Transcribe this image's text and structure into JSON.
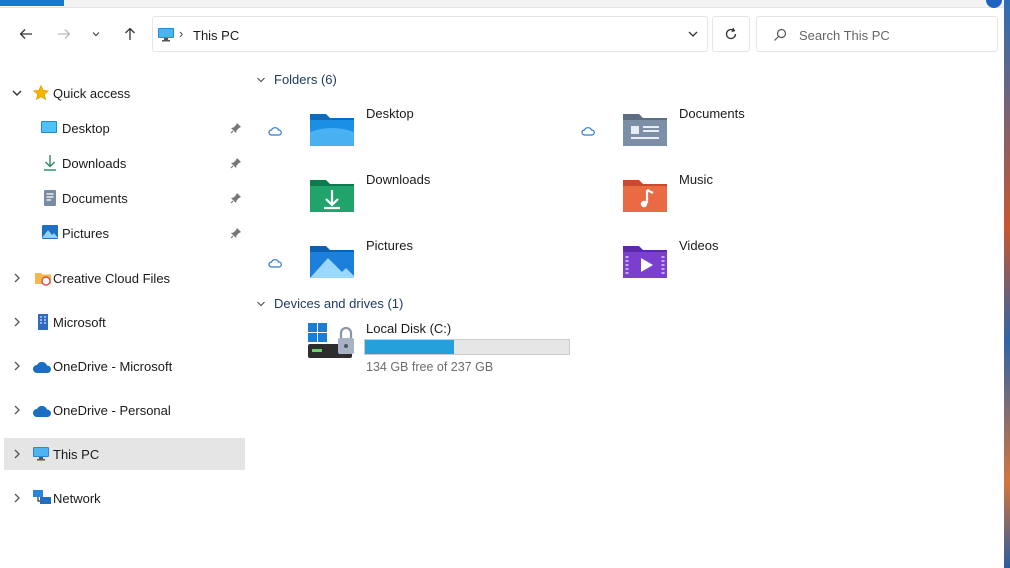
{
  "window": {
    "address": {
      "crumb": "This PC"
    },
    "search": {
      "placeholder": "Search This PC"
    }
  },
  "sidebar": {
    "items": [
      {
        "label": "Quick access",
        "icon": "star-icon",
        "expanded": true
      },
      {
        "label": "Desktop",
        "icon": "desktop-folder-icon",
        "pinned": true
      },
      {
        "label": "Downloads",
        "icon": "download-arrow-icon",
        "pinned": true
      },
      {
        "label": "Documents",
        "icon": "document-icon",
        "pinned": true
      },
      {
        "label": "Pictures",
        "icon": "picture-icon",
        "pinned": true
      },
      {
        "label": "Creative Cloud Files",
        "icon": "creative-cloud-icon"
      },
      {
        "label": "Microsoft",
        "icon": "building-icon"
      },
      {
        "label": "OneDrive - Microsoft",
        "icon": "onedrive-cloud-icon"
      },
      {
        "label": "OneDrive - Personal",
        "icon": "onedrive-cloud-icon"
      },
      {
        "label": "This PC",
        "icon": "monitor-icon",
        "selected": true
      },
      {
        "label": "Network",
        "icon": "network-icon"
      }
    ]
  },
  "content": {
    "folders_header": "Folders (6)",
    "folders": [
      {
        "label": "Desktop",
        "icon": "desktop-folder-icon",
        "cloud": true
      },
      {
        "label": "Documents",
        "icon": "documents-folder-icon",
        "cloud": true
      },
      {
        "label": "Downloads",
        "icon": "downloads-folder-icon",
        "cloud": false
      },
      {
        "label": "Music",
        "icon": "music-folder-icon",
        "cloud": false
      },
      {
        "label": "Pictures",
        "icon": "pictures-folder-icon",
        "cloud": true
      },
      {
        "label": "Videos",
        "icon": "videos-folder-icon",
        "cloud": false
      }
    ],
    "drives_header": "Devices and drives (1)",
    "drives": [
      {
        "label": "Local Disk (C:)",
        "free_text": "134 GB free of 237 GB",
        "used_fraction": 0.4346
      }
    ]
  },
  "colors": {
    "accent": "#26a0da",
    "selection": "#e5e5e5",
    "header_text": "#1f3a60"
  }
}
